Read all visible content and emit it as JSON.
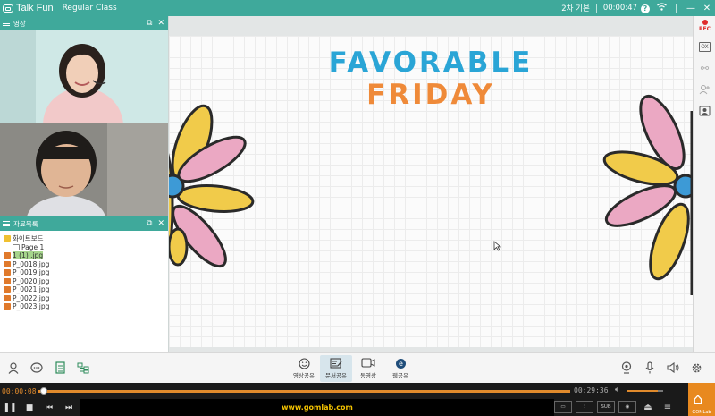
{
  "titlebar": {
    "brand": "Talk Fun",
    "class_name": "Regular Class",
    "quality": "2차 기본",
    "elapsed": "00:00:47",
    "help_icon": "?",
    "wifi_icon": "wifi-icon",
    "minimize": "—",
    "close": "✕"
  },
  "video_panel": {
    "title": "영상",
    "popout_icon": "⧉",
    "close_icon": "✕"
  },
  "resource_panel": {
    "title": "자료목록",
    "popout_icon": "⧉",
    "close_icon": "✕",
    "items": [
      {
        "label": "화이트보드",
        "type": "folder",
        "indent": 0
      },
      {
        "label": "Page 1",
        "type": "page",
        "indent": 1
      },
      {
        "label": "1 (1) .jpg",
        "type": "img",
        "indent": 0
      },
      {
        "label": "P_0018.jpg",
        "type": "img",
        "indent": 0
      },
      {
        "label": "P_0019.jpg",
        "type": "img",
        "indent": 0
      },
      {
        "label": "P_0020.jpg",
        "type": "img",
        "indent": 0
      },
      {
        "label": "P_0021.jpg",
        "type": "img",
        "indent": 0
      },
      {
        "label": "P_0022.jpg",
        "type": "img",
        "indent": 0
      },
      {
        "label": "P_0023.jpg",
        "type": "img",
        "indent": 0
      }
    ]
  },
  "board": {
    "line1": "FAVORABLE",
    "line2": "FRIDAY",
    "color_line1": "#2aa5d6",
    "color_line2": "#ef8a39"
  },
  "right_toolbar": {
    "rec_label": "REC",
    "ox_label": "OX"
  },
  "bottom_toolbar": {
    "center": [
      {
        "label": "영상공유",
        "icon": "smile-icon"
      },
      {
        "label": "문서공유",
        "icon": "document-share-icon"
      },
      {
        "label": "동영상",
        "icon": "video-camera-icon"
      },
      {
        "label": "웹공유",
        "icon": "web-share-icon"
      }
    ]
  },
  "player": {
    "current_time": "00:00:08",
    "total_time": "00:29:36",
    "progress_fraction": 0.0045,
    "url": "www.gomlab.com",
    "sub_label": "SUB",
    "gom_label": "GOMLab"
  }
}
